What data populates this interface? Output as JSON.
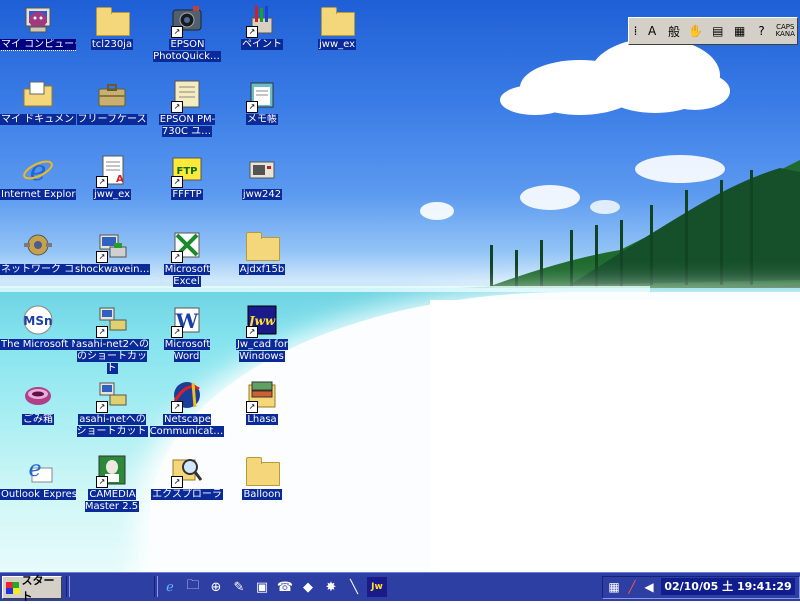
{
  "desktop_icons": [
    {
      "label": "マイ コンピュータ",
      "icon": "my-computer-icon",
      "selected": true
    },
    {
      "label": "tcl230ja",
      "icon": "folder-icon"
    },
    {
      "label": "EPSON PhotoQuick…",
      "icon": "epson-photoquicker-icon",
      "shortcut": true
    },
    {
      "label": "ペイント",
      "icon": "paint-icon",
      "shortcut": true
    },
    {
      "label": "jww_ex",
      "icon": "folder-icon"
    },
    {
      "label": "マイ ドキュメント",
      "icon": "my-documents-icon"
    },
    {
      "label": "フリーフケース",
      "icon": "briefcase-icon"
    },
    {
      "label": "EPSON PM-730C ユ…",
      "icon": "epson-printer-utility-icon",
      "shortcut": true
    },
    {
      "label": "メモ帳",
      "icon": "notepad-icon",
      "shortcut": true
    },
    {
      "label": "Internet Explorer",
      "icon": "internet-explorer-icon"
    },
    {
      "label": "jww_ex",
      "icon": "document-icon",
      "shortcut": true
    },
    {
      "label": "FFFTP",
      "icon": "ffftp-icon",
      "shortcut": true
    },
    {
      "label": "jww242",
      "icon": "archive-icon"
    },
    {
      "label": "ネットワーク コンピュータ",
      "icon": "network-computer-icon"
    },
    {
      "label": "shockwavein…",
      "icon": "installer-icon",
      "shortcut": true
    },
    {
      "label": "Microsoft Excel",
      "icon": "excel-icon",
      "shortcut": true
    },
    {
      "label": "Ajdxf15b",
      "icon": "folder-icon"
    },
    {
      "label": "The Microsoft Network の…",
      "icon": "msn-icon"
    },
    {
      "label": "asahi-net2への のショートカット",
      "icon": "dialup-icon",
      "shortcut": true
    },
    {
      "label": "Microsoft Word",
      "icon": "word-icon",
      "shortcut": true
    },
    {
      "label": "Jw_cad for Windows",
      "icon": "jwcad-icon",
      "shortcut": true
    },
    {
      "label": "ごみ箱",
      "icon": "recycle-bin-icon"
    },
    {
      "label": "asahi-netへの ショートカット",
      "icon": "dialup-icon",
      "shortcut": true
    },
    {
      "label": "Netscape Communicat…",
      "icon": "netscape-icon",
      "shortcut": true
    },
    {
      "label": "Lhasa",
      "icon": "lhasa-icon",
      "shortcut": true
    },
    {
      "label": "Outlook Express",
      "icon": "outlook-express-icon"
    },
    {
      "label": "CAMEDIA Master 2.5",
      "icon": "camedia-icon",
      "shortcut": true
    },
    {
      "label": "エクスプローラ",
      "icon": "explorer-icon",
      "shortcut": true
    },
    {
      "label": "Balloon",
      "icon": "folder-icon"
    }
  ],
  "ime_toolbar": {
    "mode": "A",
    "conversion": "般",
    "caps": "CAPS",
    "kana": "KANA"
  },
  "taskbar": {
    "start_label": "スタート",
    "quick_launch": [
      "internet-explorer-icon",
      "explorer-icon",
      "network-icon",
      "paint-icon",
      "word-icon",
      "dialup-icon",
      "ffftp-icon",
      "star-icon",
      "pen-icon",
      "jwcad-icon"
    ],
    "clock": "02/10/05 土 19:41:29"
  }
}
